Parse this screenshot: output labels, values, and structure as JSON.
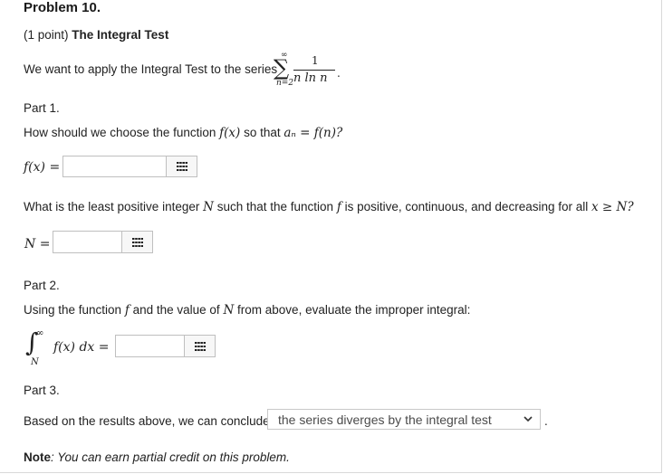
{
  "problem": {
    "title": "Problem 10.",
    "points": "(1 point)",
    "name": "The Integral Test",
    "intro": "We want to apply the Integral Test to the series",
    "series": {
      "sum_symbol": "∑",
      "upper": "∞",
      "lower": "n=2",
      "numerator": "1",
      "denominator": "n ln n",
      "end": "."
    }
  },
  "part1": {
    "heading": "Part 1.",
    "question_text": "How should we choose the function",
    "question_fx": "f(x)",
    "question_mid": "so that",
    "question_eq": "aₙ = f(n)?",
    "fx_label": "f(x) =",
    "q2_text_a": "What is the least positive integer",
    "q2_N": "N",
    "q2_text_b": "such that the function",
    "q2_f": "f",
    "q2_text_c": "is positive, continuous, and decreasing for all",
    "q2_cond": "x ≥ N?",
    "N_label": "N ="
  },
  "part2": {
    "heading": "Part 2.",
    "text_a": "Using the function",
    "text_f": "f",
    "text_b": "and the value of",
    "text_N": "N",
    "text_c": "from above, evaluate the improper integral:",
    "int_symbol": "∫",
    "int_upper": "∞",
    "int_lower": "N",
    "integrand": "f(x) dx ="
  },
  "part3": {
    "heading": "Part 3.",
    "text": "Based on the results above, we can conclude",
    "select_value": "the series diverges by the integral test",
    "end": "."
  },
  "note": {
    "label": "Note",
    "text": ": You can earn partial credit on this problem."
  },
  "colors": {
    "text": "#222222",
    "border": "#bfbfbf",
    "button_bg": "#f7f7f7"
  },
  "icons": {
    "keypad": "keypad-grid-icon",
    "dropdown": "chevron-down-icon"
  }
}
